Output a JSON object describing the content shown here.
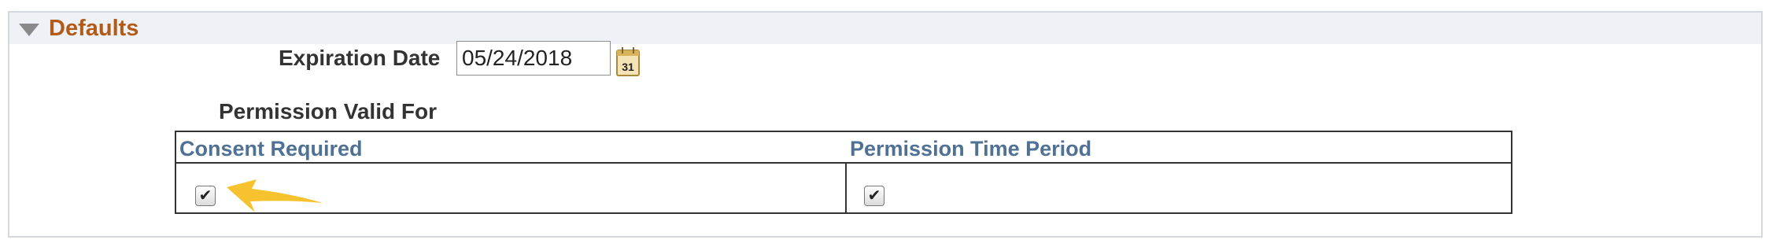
{
  "section": {
    "title": "Defaults",
    "collapse_icon": "triangle-down-icon"
  },
  "expiration": {
    "label": "Expiration Date",
    "value": "05/24/2018",
    "calendar_icon": "calendar-icon",
    "calendar_icon_text": "31"
  },
  "permission": {
    "label": "Permission Valid For",
    "columns": [
      "Consent Required",
      "Permission Time Period"
    ],
    "rows": [
      {
        "consent_required": true,
        "permission_time_period": true
      }
    ]
  },
  "annotation": {
    "arrow_icon": "arrow-left-icon",
    "color": "#f6c22e"
  },
  "colors": {
    "section_title": "#b35a17",
    "column_header": "#4f7194",
    "header_bg": "#eef2f6"
  }
}
